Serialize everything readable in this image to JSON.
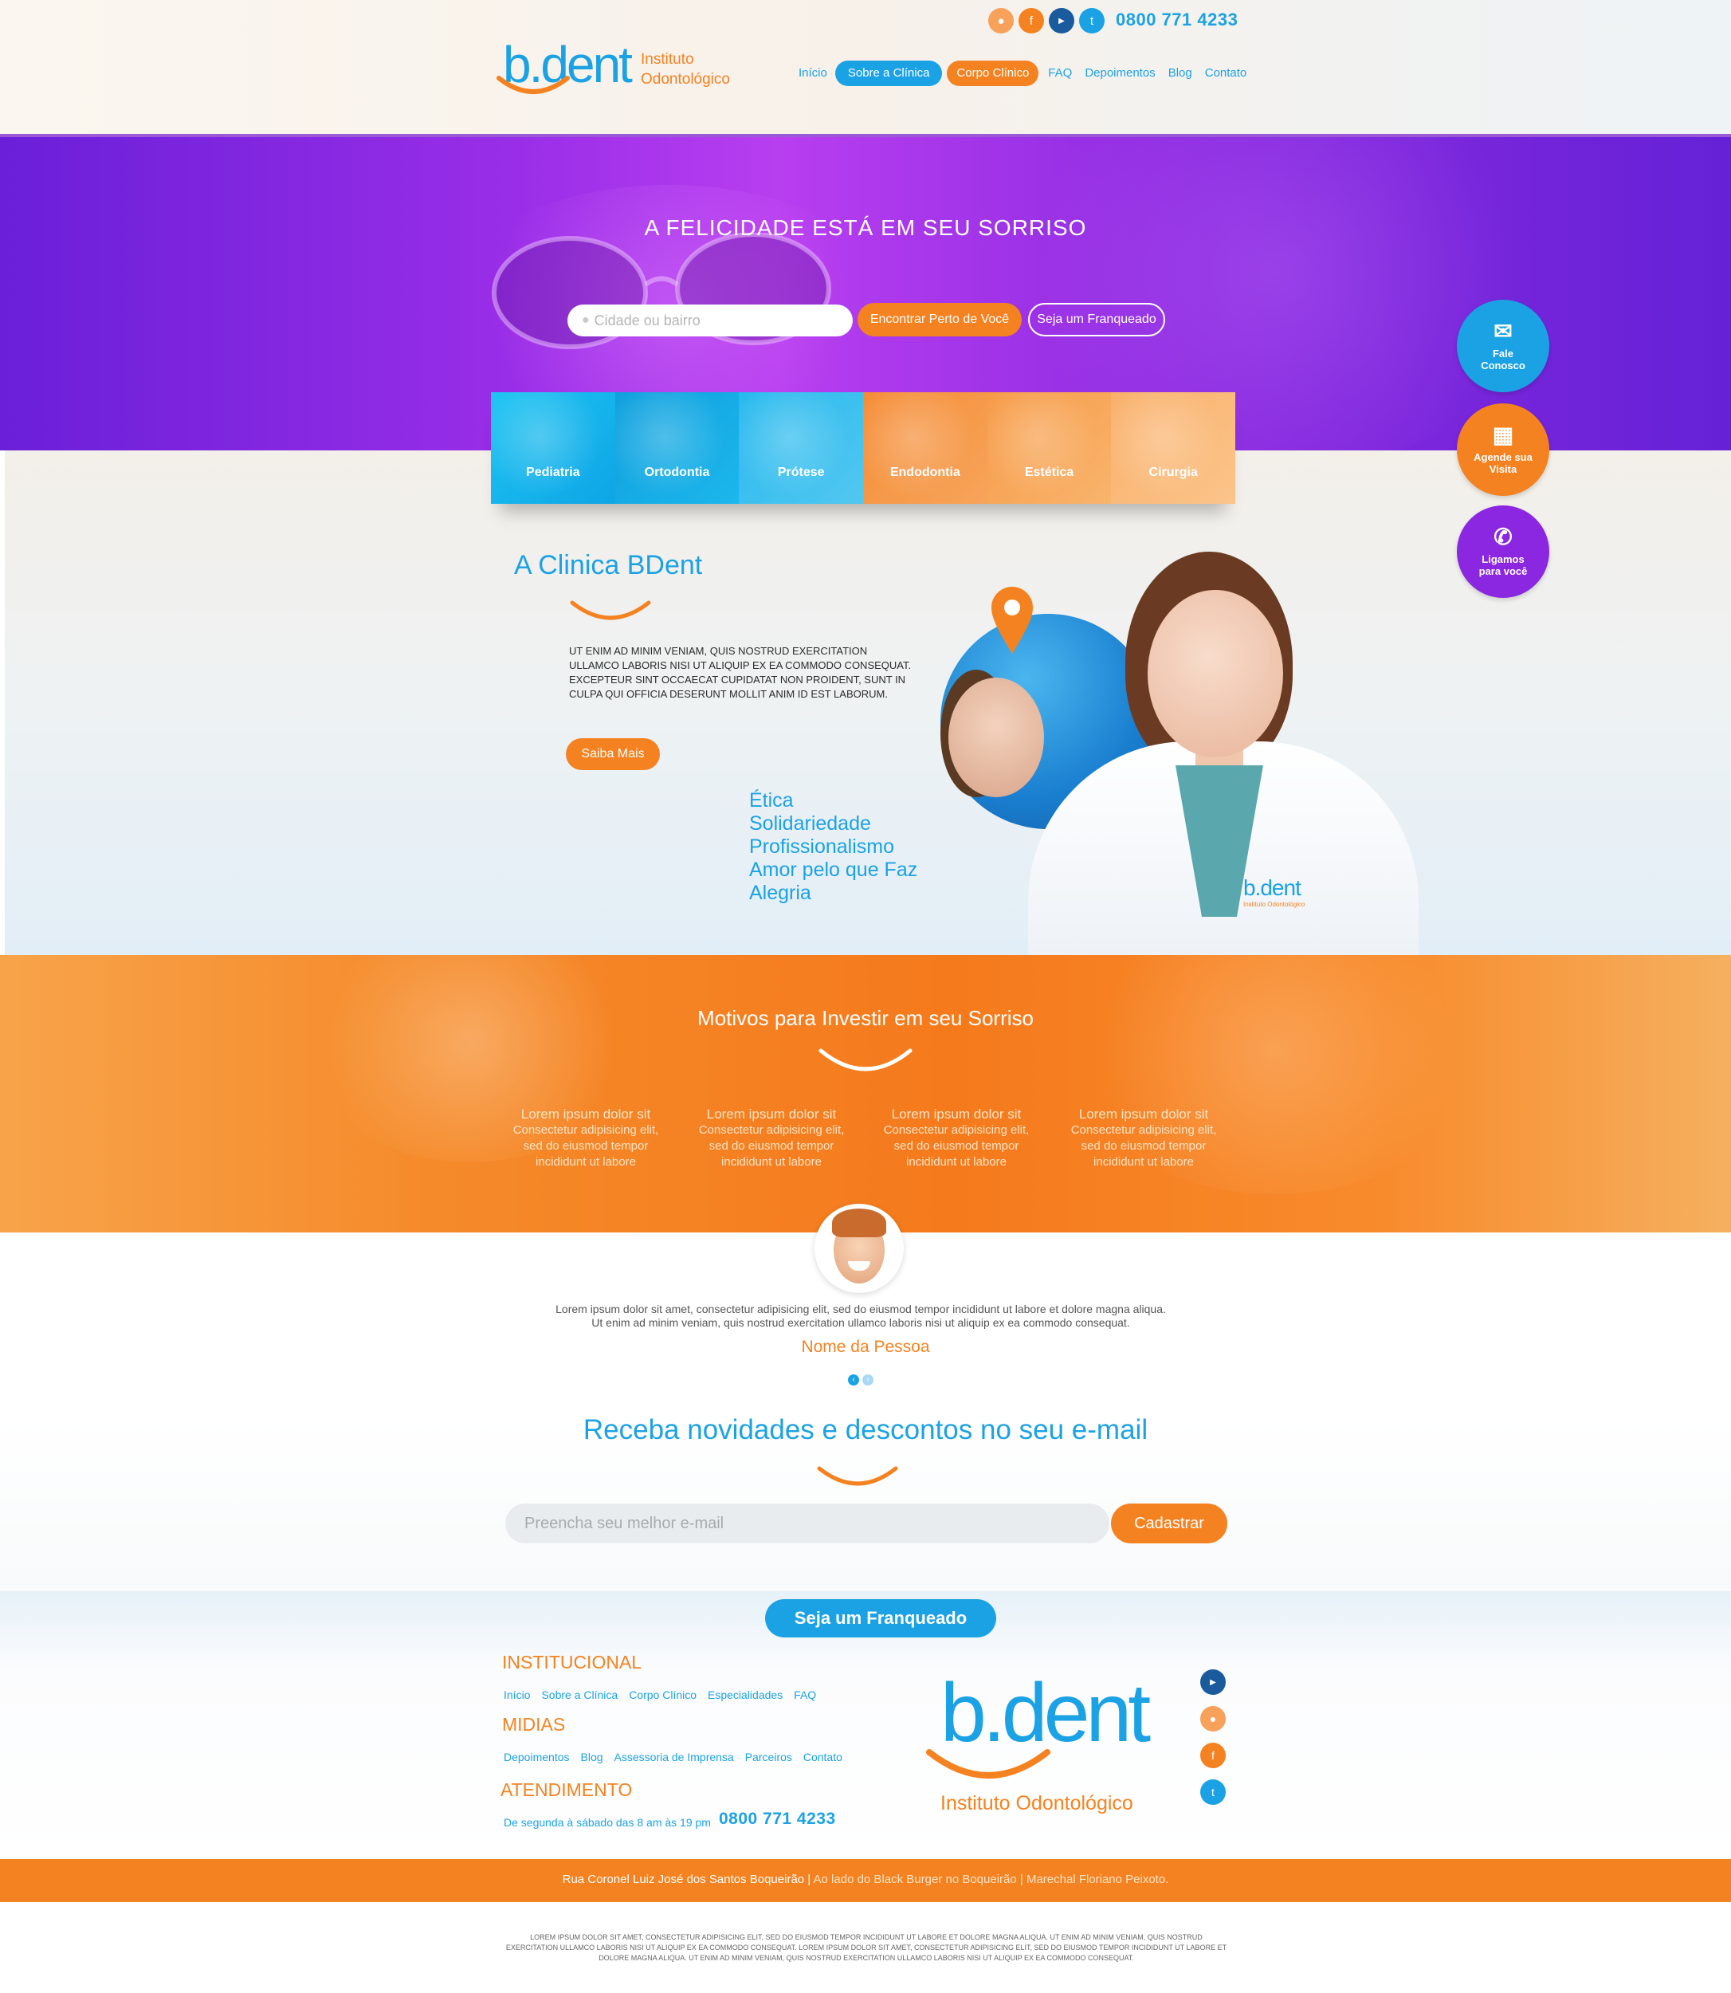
{
  "header": {
    "logo": {
      "text": "b.dent",
      "subtitle_line1": "Instituto",
      "subtitle_line2": "Odontológico"
    },
    "phone": "0800 771 4233",
    "social_icons": [
      "location-icon",
      "facebook-icon",
      "youtube-icon",
      "twitter-icon"
    ],
    "nav": [
      "Início",
      "Sobre a Clínica",
      "Corpo Clínico",
      "FAQ",
      "Depoimentos",
      "Blog",
      "Contato"
    ]
  },
  "hero": {
    "title": "A FELICIDADE ESTÁ EM SEU SORRISO",
    "search_placeholder": "Cidade ou bairro",
    "find_button": "Encontrar Perto de Você",
    "franchise_button": "Seja um Franqueado"
  },
  "floating": {
    "contact": {
      "line1": "Fale",
      "line2": "Conosco"
    },
    "schedule": {
      "line1": "Agende sua",
      "line2": "Visita"
    },
    "callback": {
      "line1": "Ligamos",
      "line2": "para você"
    }
  },
  "specialties": [
    "Pediatria",
    "Ortodontia",
    "Prótese",
    "Endodontia",
    "Estética",
    "Cirurgia"
  ],
  "about": {
    "title": "A Clinica BDent",
    "text": "UT ENIM AD MINIM VENIAM, QUIS NOSTRUD EXERCITATION ULLAMCO LABORIS NISI UT ALIQUIP EX EA COMMODO CONSEQUAT. EXCEPTEUR SINT OCCAECAT CUPIDATAT NON PROIDENT, SUNT IN CULPA QUI OFFICIA DESERUNT MOLLIT ANIM ID EST LABORUM.",
    "button": "Saiba Mais",
    "values": [
      "Ética",
      "Solidariedade",
      "Profissionalismo",
      "Amor pelo que Faz",
      "Alegria"
    ],
    "badge": {
      "logo": "b.dent",
      "sub": "Instituto Odontológico"
    }
  },
  "reasons": {
    "title": "Motivos para Investir em seu Sorriso",
    "items": [
      {
        "title": "Lorem ipsum dolor sit",
        "body": "Consectetur adipisicing elit, sed do eiusmod tempor incididunt ut labore"
      },
      {
        "title": "Lorem ipsum dolor sit",
        "body": "Consectetur adipisicing elit, sed do eiusmod tempor incididunt ut labore"
      },
      {
        "title": "Lorem ipsum dolor sit",
        "body": "Consectetur adipisicing elit, sed do eiusmod tempor incididunt ut labore"
      },
      {
        "title": "Lorem ipsum dolor sit",
        "body": "Consectetur adipisicing elit, sed do eiusmod tempor incididunt ut labore"
      }
    ]
  },
  "testimonial": {
    "text": "Lorem ipsum dolor sit amet, consectetur adipisicing elit, sed do eiusmod tempor incididunt ut labore et dolore magna aliqua. Ut enim ad minim veniam, quis nostrud exercitation ullamco laboris nisi ut aliquip ex ea commodo consequat.",
    "name": "Nome da Pessoa",
    "dots": [
      "‹",
      "›"
    ]
  },
  "newsletter": {
    "title": "Receba novidades e descontos no seu e-mail",
    "placeholder": "Preencha seu melhor e-mail",
    "button": "Cadastrar"
  },
  "footer": {
    "franchise_button": "Seja um Franqueado",
    "institucional": {
      "title": "INSTITUCIONAL",
      "links": [
        "Início",
        "Sobre a Clínica",
        "Corpo Clínico",
        "Especialidades",
        "FAQ"
      ]
    },
    "midias": {
      "title": "MIDIAS",
      "links": [
        "Depoimentos",
        "Blog",
        "Assessoria de Imprensa",
        "Parceiros",
        "Contato"
      ]
    },
    "atendimento": {
      "title": "ATENDIMENTO",
      "hours": "De segunda à sábado das 8 am às 19 pm",
      "phone": "0800 771 4233"
    },
    "logo": {
      "text": "b.dent",
      "sub": "Instituto Odontológico"
    },
    "social_icons": [
      "youtube-icon",
      "location-icon",
      "facebook-icon",
      "twitter-icon"
    ],
    "address_main": "Rua Coronel Luiz José dos Santos  Boqueirão |",
    "address_rest": " Ao lado do Black Burger no Boqueirão | Marechal Floriano Peixoto.",
    "legal": "LOREM IPSUM DOLOR SIT AMET, CONSECTETUR ADIPISICING ELIT, SED DO EIUSMOD TEMPOR INCIDIDUNT UT LABORE ET DOLORE MAGNA ALIQUA. UT ENIM AD MINIM VENIAM, QUIS NOSTRUD EXERCITATION ULLAMCO LABORIS NISI UT ALIQUIP EX EA COMMODO CONSEQUAT. LOREM IPSUM DOLOR SIT AMET, CONSECTETUR ADIPISICING ELIT, SED DO EIUSMOD TEMPOR INCIDIDUNT UT LABORE ET DOLORE MAGNA ALIQUA. UT ENIM AD MINIM VENIAM, QUIS NOSTRUD EXERCITATION ULLAMCO LABORIS NISI UT ALIQUIP EX EA COMMODO CONSEQUAT."
  },
  "colors": {
    "blue": "#1ba2e4",
    "orange": "#f58220",
    "purple": "#8b27e0",
    "navy": "#195b9c"
  }
}
